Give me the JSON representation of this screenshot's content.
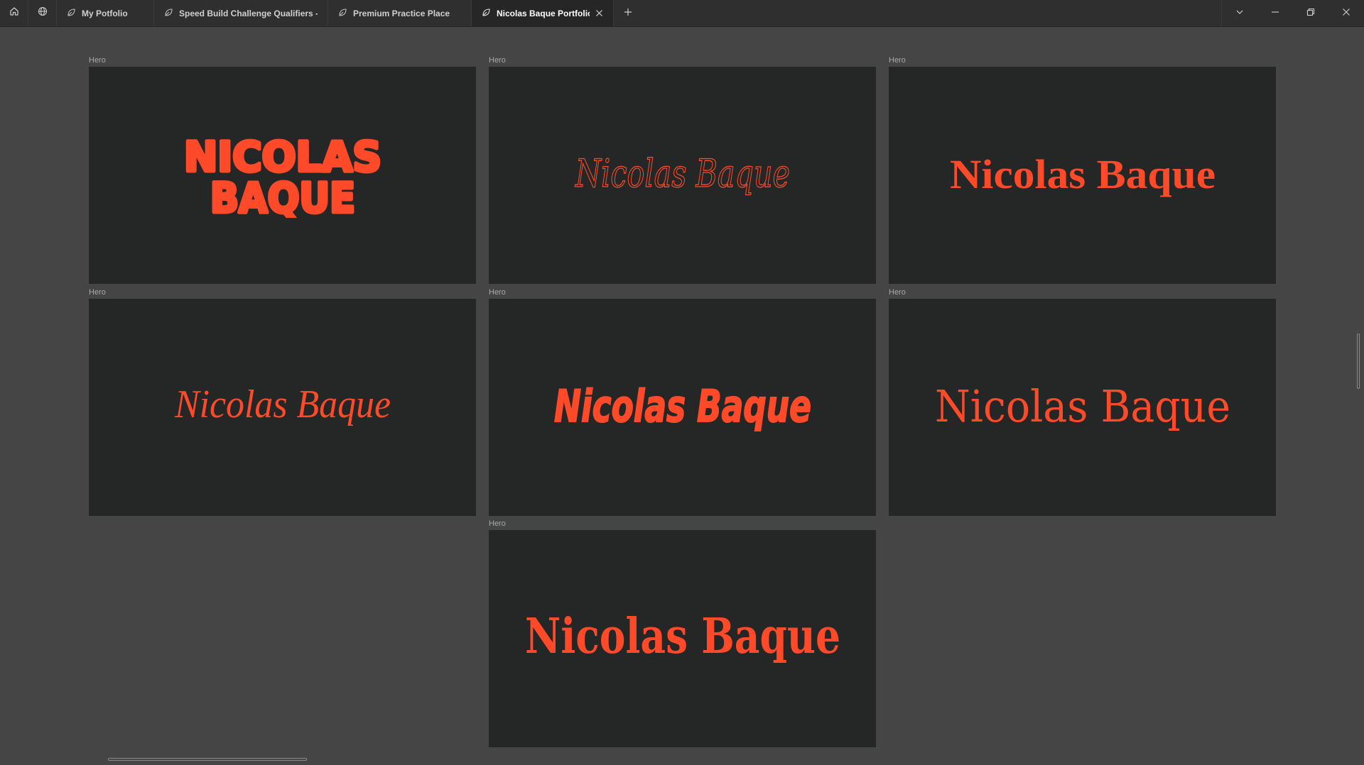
{
  "window": {
    "tabs": [
      {
        "label": "My Potfolio",
        "active": false
      },
      {
        "label": "Speed Build Challenge Qualifiers - De",
        "active": false
      },
      {
        "label": "Premium Practice Place",
        "active": false
      },
      {
        "label": "Nicolas Baque Portfolio",
        "active": true
      }
    ],
    "icons": {
      "home": "home-icon",
      "globe": "globe-icon",
      "tab_leaf": "leaf-icon",
      "close": "close-icon",
      "new_tab": "plus-icon",
      "dropdown": "chevron-down-icon",
      "minimize": "minimize-icon",
      "restore": "restore-icon",
      "close_window": "close-window-icon"
    }
  },
  "frames": [
    {
      "label": "Hero",
      "line1": "NICOLAS",
      "line2": "BAQUE",
      "style": "bubble"
    },
    {
      "label": "Hero",
      "text": "Nicolas Baque",
      "style": "thin-script"
    },
    {
      "label": "Hero",
      "text": "Nicolas Baque",
      "style": "blackletter"
    },
    {
      "label": "Hero",
      "text": "Nicolas Baque",
      "style": "script"
    },
    {
      "label": "Hero",
      "text": "Nicolas Baque",
      "style": "heavy-italic"
    },
    {
      "label": "Hero",
      "text": "Nicolas Baque",
      "style": "blackletter-wide"
    },
    {
      "label": "Hero",
      "text": "Nicolas Baque",
      "style": "bold-serif"
    }
  ],
  "colors": {
    "canvas": "#454545",
    "frame": "#252727",
    "accent": "#ff4a2a",
    "tabbar": "#2f2f2f"
  }
}
